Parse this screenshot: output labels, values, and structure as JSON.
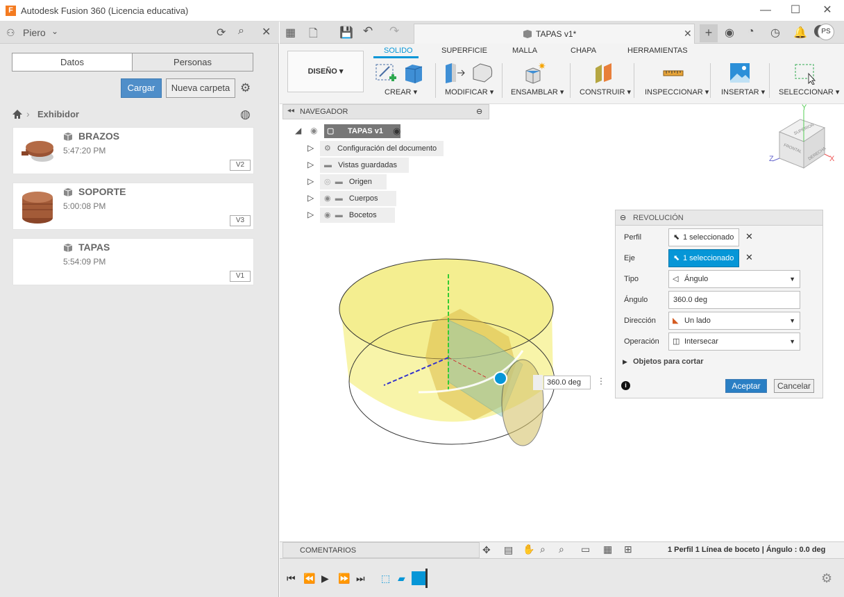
{
  "window": {
    "title": "Autodesk Fusion 360 (Licencia educativa)",
    "logo_letter": "F"
  },
  "left_panel": {
    "user": "Piero",
    "tabs": [
      "Datos",
      "Personas"
    ],
    "upload_label": "Cargar",
    "new_folder_label": "Nueva carpeta",
    "breadcrumb": "Exhibidor",
    "files": [
      {
        "name": "BRAZOS",
        "time": "5:47:20 PM",
        "version": "V2"
      },
      {
        "name": "SOPORTE",
        "time": "5:00:08 PM",
        "version": "V3"
      },
      {
        "name": "TAPAS",
        "time": "5:54:09 PM",
        "version": "V1"
      }
    ]
  },
  "document": {
    "tab_title": "TAPAS v1*",
    "user_initials": "PS"
  },
  "toolbar": {
    "workspace": "DISEÑO",
    "tabs": [
      "SOLIDO",
      "SUPERFICIE",
      "MALLA",
      "CHAPA",
      "HERRAMIENTAS"
    ],
    "active_tab": "SOLIDO",
    "groups": [
      "CREAR",
      "MODIFICAR",
      "ENSAMBLAR",
      "CONSTRUIR",
      "INSPECCIONAR",
      "INSERTAR",
      "SELECCIONAR"
    ]
  },
  "navigator": {
    "title": "NAVEGADOR",
    "root": "TAPAS v1",
    "items": [
      "Configuración del documento",
      "Vistas guardadas",
      "Origen",
      "Cuerpos",
      "Bocetos"
    ]
  },
  "viewcube": {
    "faces": [
      "SUPERIOR",
      "FRONTAL",
      "DERECHA"
    ],
    "axes": [
      "Y",
      "Z",
      "X"
    ]
  },
  "revolution": {
    "title": "REVOLUCIÓN",
    "rows": [
      {
        "label": "Perfil",
        "value": "1 seleccionado"
      },
      {
        "label": "Eje",
        "value": "1 seleccionado"
      },
      {
        "label": "Tipo",
        "value": "Ángulo"
      },
      {
        "label": "Ángulo",
        "value": "360.0 deg"
      },
      {
        "label": "Dirección",
        "value": "Un lado"
      },
      {
        "label": "Operación",
        "value": "Intersecar"
      }
    ],
    "objects_label": "Objetos para cortar",
    "ok_label": "Aceptar",
    "cancel_label": "Cancelar"
  },
  "viewport": {
    "angle_input": "360.0 deg"
  },
  "bottom": {
    "comments": "COMENTARIOS",
    "status": "1 Perfil 1 Línea de boceto | Ángulo : 0.0 deg"
  },
  "colors": {
    "accent": "#0696d7",
    "upload": "#4f8ec9",
    "body_fill": "#f7f3a0"
  }
}
